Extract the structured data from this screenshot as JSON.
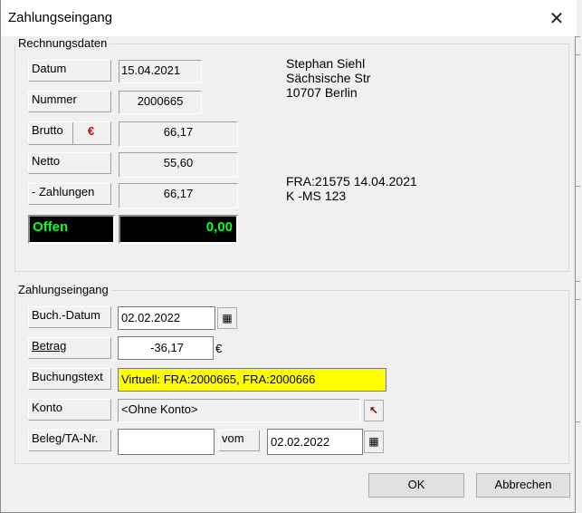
{
  "window": {
    "title": "Zahlungseingang",
    "close_glyph": "✕"
  },
  "rechnungsdaten": {
    "legend": "Rechnungsdaten",
    "datum_label": "Datum",
    "datum_value": "15.04.2021",
    "nummer_label": "Nummer",
    "nummer_value": "2000665",
    "brutto_label": "Brutto",
    "currency_symbol": "€",
    "brutto_value": "66,17",
    "netto_label": "Netto",
    "netto_value": "55,60",
    "zahlungen_label": "- Zahlungen",
    "zahlungen_value": "66,17",
    "offen_label": "Offen",
    "offen_value": "0,00",
    "address": [
      "Stephan Siehl",
      "Sächsische Str",
      "10707 Berlin"
    ],
    "reference": [
      "FRA:21575 14.04.2021",
      "K  -MS 123"
    ]
  },
  "zahlungseingang": {
    "legend": "Zahlungseingang",
    "buchdatum_label": "Buch.-Datum",
    "buchdatum_value": "02.02.2022",
    "betrag_label": "Betrag",
    "betrag_value": "-36,17",
    "betrag_unit": "€",
    "buchungstext_label": "Buchungstext",
    "buchungstext_value": "Virtuell: FRA:2000665, FRA:2000666",
    "konto_label": "Konto",
    "konto_value": "<Ohne Konto>",
    "beleg_label": "Beleg/TA-Nr.",
    "beleg_value": "",
    "vom_label": "vom",
    "vom_value": "02.02.2022"
  },
  "buttons": {
    "ok": "OK",
    "cancel": "Abbrechen"
  },
  "icons": {
    "calendar": "calendar-icon",
    "jump": "jump-arrow-icon",
    "close": "close-icon"
  },
  "colors": {
    "highlight": "#ffff00",
    "offen_text": "#00ff2b",
    "euro": "#e00000",
    "jump_arrow": "#800000"
  }
}
